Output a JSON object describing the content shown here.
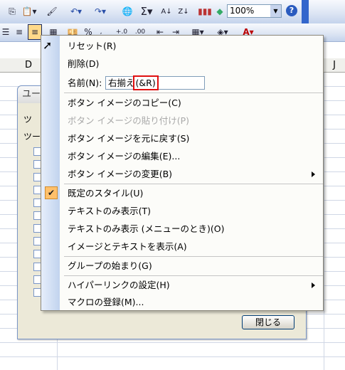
{
  "toolbar": {
    "sigma": "Σ",
    "az": "A↓",
    "za": "Z↓",
    "zoom": "100%",
    "help": "?",
    "percent": "%",
    "font_a": "A"
  },
  "columns": {
    "d": "D",
    "j": "J"
  },
  "dialog": {
    "title_partial": "ユー",
    "label1": "ツ",
    "label2": "ツー",
    "close_label": "閉じる"
  },
  "menu": {
    "reset": "リセット(R)",
    "delete": "削除(D)",
    "name_label": "名前(N):",
    "name_value_prefix": "右揃え",
    "name_value_suffix": "(&R)",
    "copy_image": "ボタン イメージのコピー(C)",
    "paste_image": "ボタン イメージの貼り付け(P)",
    "reset_image": "ボタン イメージを元に戻す(S)",
    "edit_image": "ボタン イメージの編集(E)...",
    "change_image": "ボタン イメージの変更(B)",
    "default_style": "既定のスタイル(U)",
    "text_only": "テキストのみ表示(T)",
    "text_only_menu": "テキストのみ表示 (メニューのとき)(O)",
    "image_and_text": "イメージとテキストを表示(A)",
    "begin_group": "グループの始まり(G)",
    "hyperlink": "ハイパーリンクの設定(H)",
    "assign_macro": "マクロの登録(M)..."
  }
}
